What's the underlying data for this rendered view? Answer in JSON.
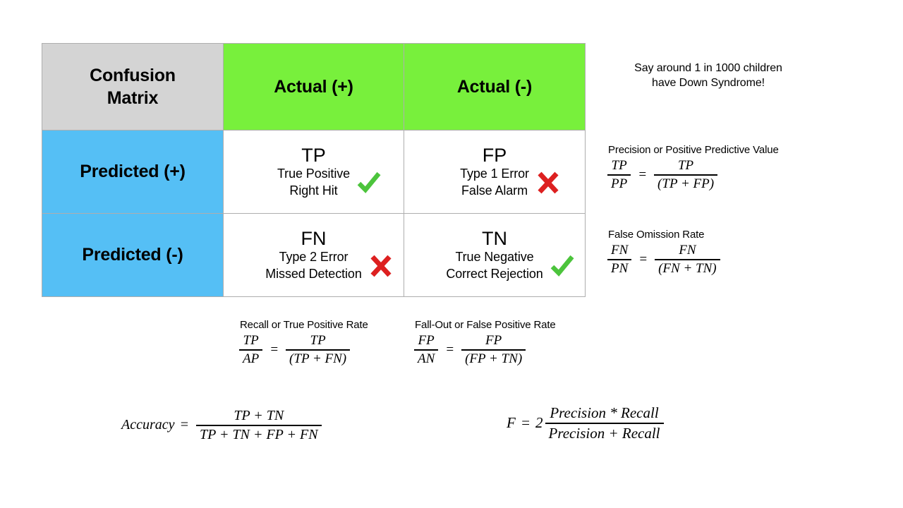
{
  "matrix": {
    "title": "Confusion\nMatrix",
    "title_line1": "Confusion",
    "title_line2": "Matrix",
    "columns": [
      {
        "label": "Actual (+)"
      },
      {
        "label": "Actual (-)"
      }
    ],
    "rows": [
      {
        "label": "Predicted (+)"
      },
      {
        "label": "Predicted (-)"
      }
    ],
    "cells": [
      {
        "abbr": "TP",
        "line1": "True Positive",
        "line2": "Right Hit",
        "mark": "check-mark-icon",
        "mark_color": "#4CC43C"
      },
      {
        "abbr": "FP",
        "line1": "Type 1 Error",
        "line2": "False Alarm",
        "mark": "cross-mark-icon",
        "mark_color": "#DD2020"
      },
      {
        "abbr": "FN",
        "line1": "Type 2 Error",
        "line2": "Missed Detection",
        "mark": "cross-mark-icon",
        "mark_color": "#DD2020"
      },
      {
        "abbr": "TN",
        "line1": "True Negative",
        "line2": "Correct Rejection",
        "mark": "check-mark-icon",
        "mark_color": "#4CC43C"
      }
    ],
    "colors": {
      "title_cell": "#D4D4D4",
      "actual_header": "#78F03C",
      "predicted_header": "#55BFF5",
      "data_cell": "#FFFFFF",
      "grid_line": "#AEAEAE"
    }
  },
  "note": {
    "line1": "Say around 1 in 1000 children",
    "line2": "have Down Syndrome!"
  },
  "metrics": [
    {
      "id": "precision",
      "label": "Precision or Positive Predictive Value",
      "lhs_num": "TP",
      "lhs_den": "PP",
      "equals": "=",
      "rhs_num": "TP",
      "rhs_den": "(TP + FP)"
    },
    {
      "id": "false_omission_rate",
      "label": "False Omission Rate",
      "lhs_num": "FN",
      "lhs_den": "PN",
      "equals": "=",
      "rhs_num": "FN",
      "rhs_den": "(FN + TN)"
    },
    {
      "id": "recall",
      "label": "Recall or True Positive Rate",
      "lhs_num": "TP",
      "lhs_den": "AP",
      "equals": "=",
      "rhs_num": "TP",
      "rhs_den": "(TP + FN)"
    },
    {
      "id": "fall_out",
      "label": "Fall-Out or False Positive Rate",
      "lhs_num": "FP",
      "lhs_den": "AN",
      "equals": "=",
      "rhs_num": "FP",
      "rhs_den": "(FP + TN)"
    }
  ],
  "accuracy": {
    "name": "Accuracy",
    "equals": "=",
    "num": "TP + TN",
    "den": "TP + TN + FP + FN"
  },
  "fscore": {
    "name": "F",
    "equals": "=",
    "coefficient": "2",
    "num": "Precision * Recall",
    "den": "Precision + Recall"
  }
}
